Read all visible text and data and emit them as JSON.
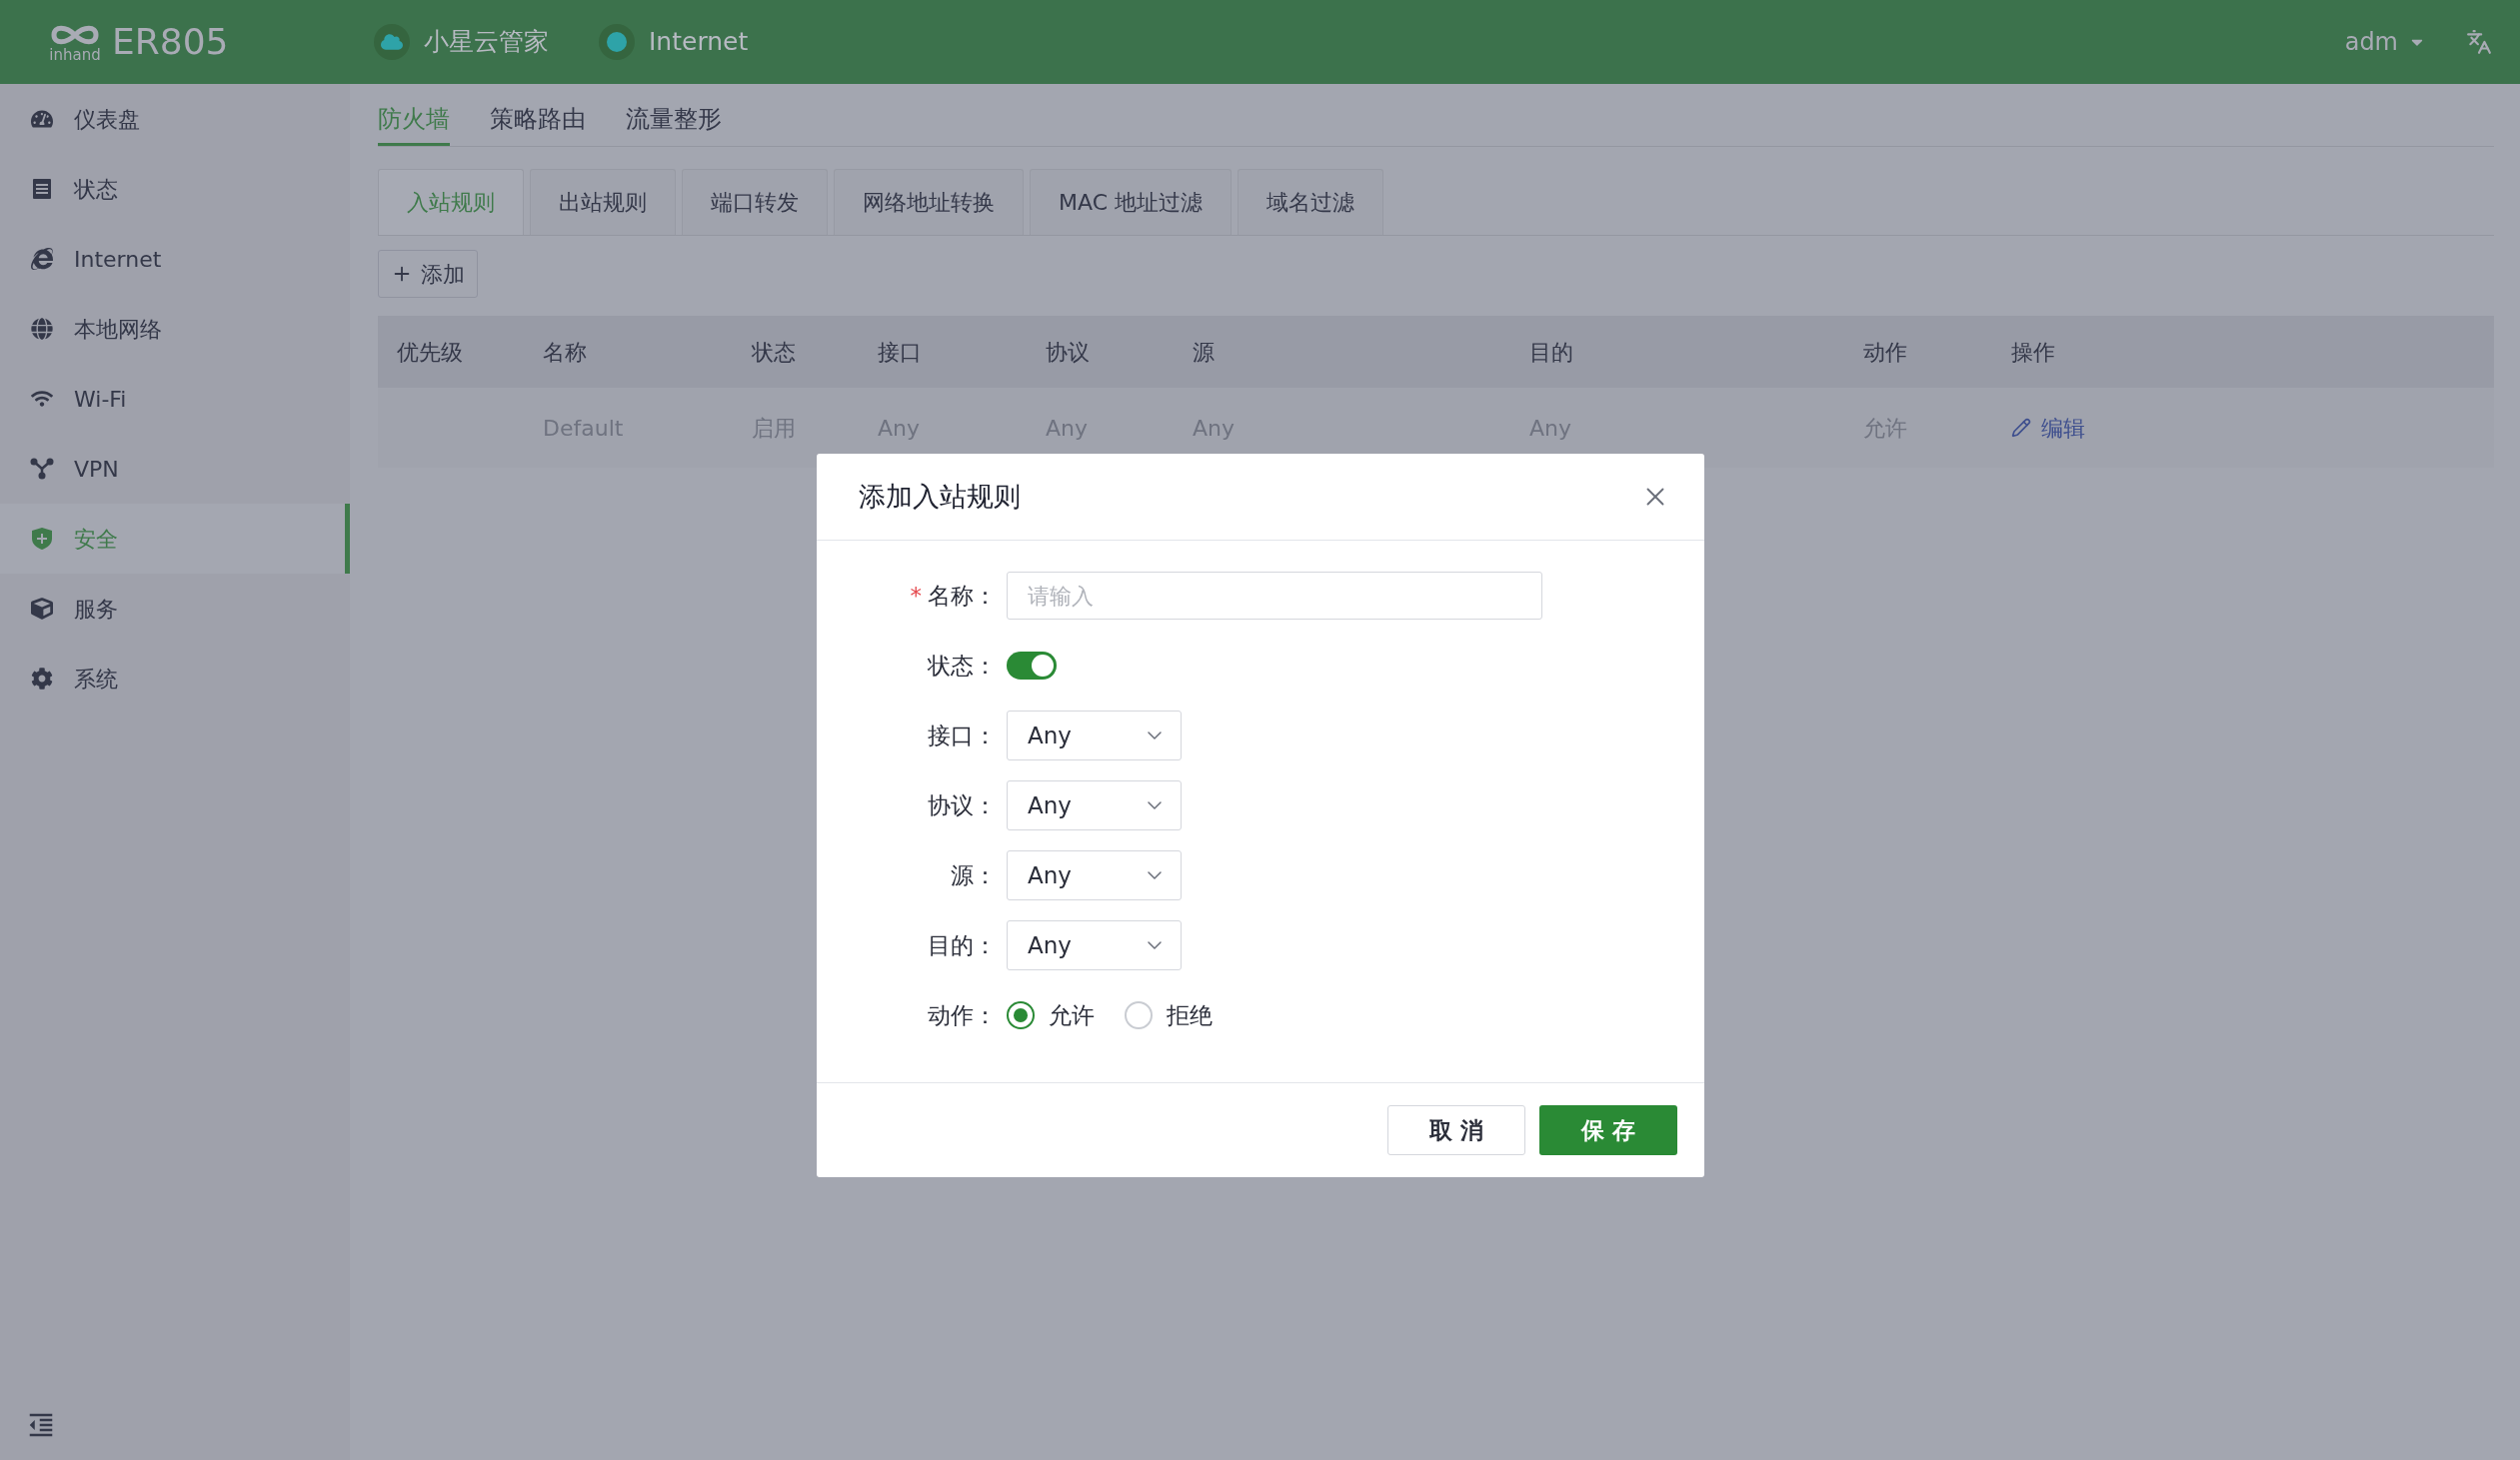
{
  "header": {
    "logo_text": "inhand",
    "product": "ER805",
    "status_items": [
      {
        "kind": "cloud",
        "label": "小星云管家"
      },
      {
        "kind": "dot",
        "label": "Internet"
      }
    ],
    "user": "adm"
  },
  "sidebar": {
    "items": [
      {
        "label": "仪表盘",
        "selected": false
      },
      {
        "label": "状态",
        "selected": false
      },
      {
        "label": "Internet",
        "selected": false
      },
      {
        "label": "本地网络",
        "selected": false
      },
      {
        "label": "Wi-Fi",
        "selected": false
      },
      {
        "label": "VPN",
        "selected": false
      },
      {
        "label": "安全",
        "selected": true
      },
      {
        "label": "服务",
        "selected": false
      },
      {
        "label": "系统",
        "selected": false
      }
    ]
  },
  "top_tabs": [
    {
      "label": "防火墙",
      "selected": true
    },
    {
      "label": "策略路由",
      "selected": false
    },
    {
      "label": "流量整形",
      "selected": false
    }
  ],
  "sub_tabs": [
    {
      "label": "入站规则",
      "selected": true
    },
    {
      "label": "出站规则",
      "selected": false
    },
    {
      "label": "端口转发",
      "selected": false
    },
    {
      "label": "网络地址转换",
      "selected": false
    },
    {
      "label": "MAC 地址过滤",
      "selected": false
    },
    {
      "label": "域名过滤",
      "selected": false
    }
  ],
  "add_button": "添加",
  "table": {
    "columns": [
      "优先级",
      "名称",
      "状态",
      "接口",
      "协议",
      "源",
      "目的",
      "动作",
      "操作"
    ],
    "rows": [
      {
        "name": "Default",
        "status": "启用",
        "interface": "Any",
        "protocol": "Any",
        "source": "Any",
        "destination": "Any",
        "action": "允许",
        "edit": "编辑"
      }
    ]
  },
  "dialog": {
    "title": "添加入站规则",
    "fields": [
      {
        "kind": "text",
        "label": "名称：",
        "required_mark": "*",
        "placeholder": "请输入"
      },
      {
        "kind": "switch",
        "label": "状态：",
        "on": true
      },
      {
        "kind": "select",
        "label": "接口：",
        "value": "Any"
      },
      {
        "kind": "select",
        "label": "协议：",
        "value": "Any"
      },
      {
        "kind": "select",
        "label": "源：",
        "value": "Any"
      },
      {
        "kind": "select",
        "label": "目的：",
        "value": "Any"
      },
      {
        "kind": "radio",
        "label": "动作：",
        "options": [
          {
            "label": "允许",
            "selected": true
          },
          {
            "label": "拒绝",
            "selected": false
          }
        ]
      }
    ],
    "buttons": [
      {
        "kind": "secondary",
        "label": "取 消"
      },
      {
        "kind": "primary",
        "label": "保 存"
      }
    ]
  }
}
